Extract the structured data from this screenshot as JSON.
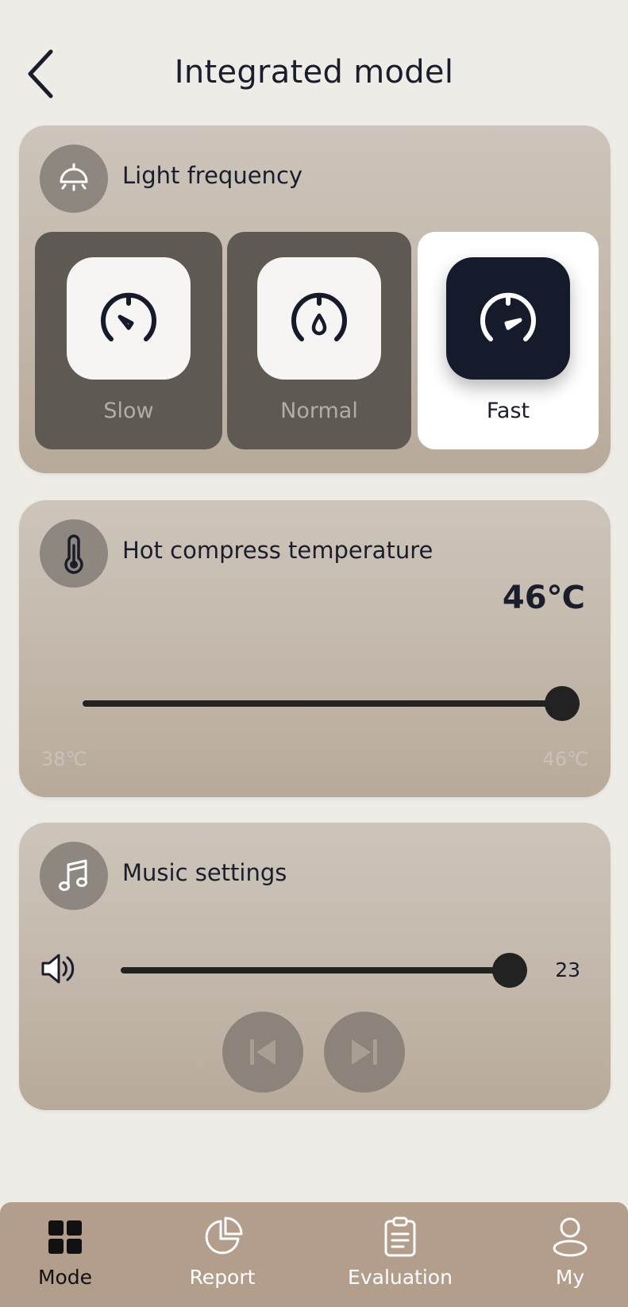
{
  "header": {
    "title": "Integrated model",
    "back_icon": "chevron-left-icon"
  },
  "light_frequency": {
    "title": "Light frequency",
    "icon": "ceiling-lamp-icon",
    "options": [
      {
        "label": "Slow",
        "icon": "speedometer-slow-icon",
        "selected": false
      },
      {
        "label": "Normal",
        "icon": "speedometer-normal-icon",
        "selected": false
      },
      {
        "label": "Fast",
        "icon": "speedometer-fast-icon",
        "selected": true
      }
    ]
  },
  "hot_compress": {
    "title": "Hot compress temperature",
    "icon": "thermometer-icon",
    "value_label": "46℃",
    "value": 46,
    "min": 38,
    "max": 46,
    "min_label": "38℃",
    "max_label": "46℃"
  },
  "music": {
    "title": "Music settings",
    "icon": "music-note-icon",
    "volume_label": "23",
    "volume_fraction": 1.0,
    "controls": [
      "skip-previous-icon",
      "skip-next-icon"
    ]
  },
  "nav": {
    "items": [
      {
        "label": "Mode",
        "icon": "grid-icon",
        "active": true
      },
      {
        "label": "Report",
        "icon": "pie-chart-icon",
        "active": false
      },
      {
        "label": "Evaluation",
        "icon": "clipboard-icon",
        "active": false
      },
      {
        "label": "My",
        "icon": "user-icon",
        "active": false
      }
    ]
  },
  "colors": {
    "background": "#eeece7",
    "card": "#c4b9ad",
    "accent_dark": "#151b2b",
    "nav_bar": "#b39d8b",
    "option_unselected": "#5f5954"
  }
}
